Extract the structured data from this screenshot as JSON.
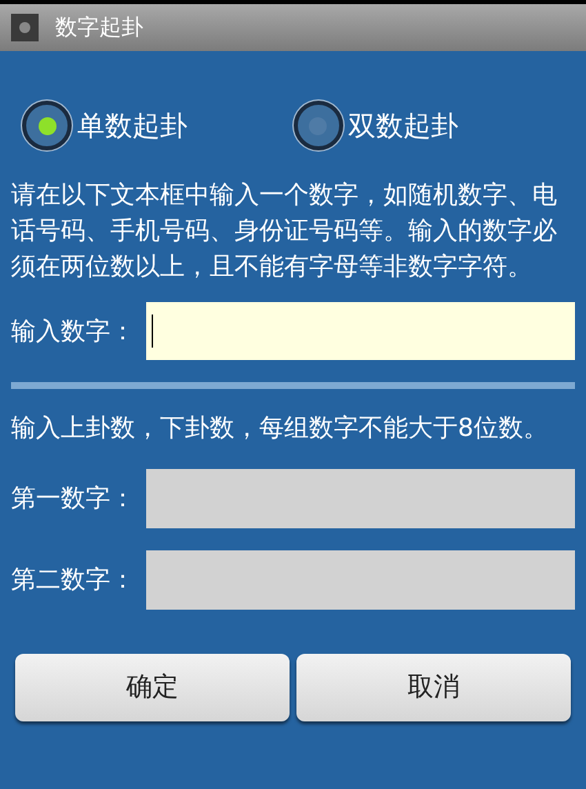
{
  "window": {
    "title": "数字起卦"
  },
  "modes": [
    {
      "label": "单数起卦",
      "selected": true
    },
    {
      "label": "双数起卦",
      "selected": false
    }
  ],
  "instructions": "请在以下文本框中输入一个数字，如随机数字、电话号码、手机号码、身份证号码等。输入的数字必须在两位数以上，且不能有字母等非数字字符。",
  "number_field": {
    "label": "输入数字：",
    "focused": true
  },
  "pair_instructions": "输入上卦数，下卦数，每组数字不能大于8位数。",
  "pair_fields": [
    {
      "label": "第一数字：",
      "disabled": true
    },
    {
      "label": "第二数字：",
      "disabled": true
    }
  ],
  "buttons": [
    "确定",
    "取消"
  ]
}
